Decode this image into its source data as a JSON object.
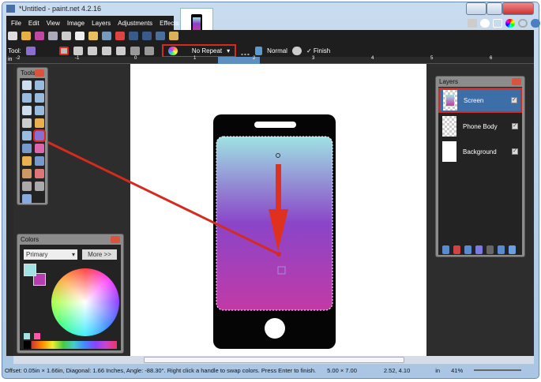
{
  "window": {
    "title": "*Untitled - paint.net 4.2.16"
  },
  "menu": [
    "File",
    "Edit",
    "View",
    "Image",
    "Layers",
    "Adjustments",
    "Effects"
  ],
  "tool_options": {
    "tool_label": "Tool:",
    "repeat_mode": "No Repeat",
    "blend_mode": "Normal",
    "finish_label": "Finish"
  },
  "ruler": {
    "unit": "in",
    "ticks": [
      "-2",
      "-1",
      "0",
      "1",
      "2",
      "3",
      "4",
      "5",
      "6"
    ]
  },
  "tools_panel": {
    "title": "Tools",
    "text_tool": "T"
  },
  "colors_panel": {
    "title": "Colors",
    "mode": "Primary",
    "more_label": "More >>",
    "primary": "#9fe3e3",
    "secondary": "#b83bb0"
  },
  "layers_panel": {
    "title": "Layers",
    "layers": [
      {
        "name": "Screen",
        "visible": "✓"
      },
      {
        "name": "Phone Body",
        "visible": "✓"
      },
      {
        "name": "Background",
        "visible": "✓"
      }
    ]
  },
  "status": {
    "message": "Offset: 0.05in × 1.66in, Diagonal: 1.66 Inches, Angle: -88.30°. Right click a handle to swap colors. Press Enter to finish.",
    "image_size": "5.00 × 7.00",
    "cursor": "2.52, 4.10",
    "unit": "in",
    "zoom": "41%"
  },
  "colors": {
    "accent": "#d52b1e",
    "selection": "#3d6ea8"
  }
}
